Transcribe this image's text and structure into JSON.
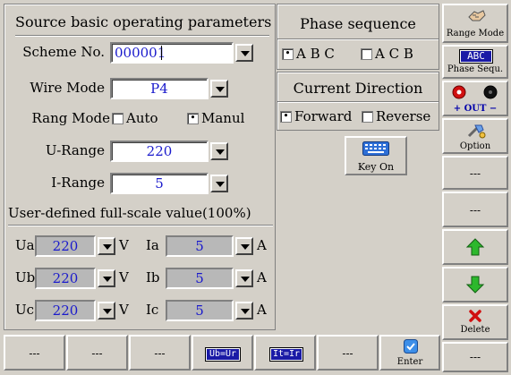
{
  "left_panel": {
    "title": "Source basic operating parameters",
    "scheme_label": "Scheme No.",
    "scheme_value": "000001",
    "wire_label": "Wire Mode",
    "wire_value": "P4",
    "rang_label": "Rang Mode",
    "rang_auto": "Auto",
    "rang_manual": "Manul",
    "u_range_label": "U-Range",
    "u_range_value": "220",
    "i_range_label": "I-Range",
    "i_range_value": "5",
    "fullscale_title": "User-defined full-scale value(100%)",
    "rows": [
      {
        "u_label": "Ua",
        "u_value": "220",
        "u_unit": "V",
        "i_label": "Ia",
        "i_value": "5",
        "i_unit": "A"
      },
      {
        "u_label": "Ub",
        "u_value": "220",
        "u_unit": "V",
        "i_label": "Ib",
        "i_value": "5",
        "i_unit": "A"
      },
      {
        "u_label": "Uc",
        "u_value": "220",
        "u_unit": "V",
        "i_label": "Ic",
        "i_value": "5",
        "i_unit": "A"
      }
    ]
  },
  "phase": {
    "title": "Phase sequence",
    "opt_abc": "A B C",
    "opt_acb": "A C B",
    "abc_checked": true
  },
  "current": {
    "title": "Current Direction",
    "opt_forward": "Forward",
    "opt_reverse": "Reverse",
    "forward_checked": true
  },
  "key_on": {
    "label": "Key On"
  },
  "sidebar": {
    "range_mode": "Range Mode",
    "phase_badge": "ABC",
    "phase_sequ": "Phase Sequ.",
    "out_label": "+ OUT −",
    "option": "Option",
    "blank1": "---",
    "blank2": "---",
    "blank3": "---",
    "delete": "Delete"
  },
  "bottom": {
    "b1": "---",
    "b2": "---",
    "b3": "---",
    "ub_ur": "Ub=Ur",
    "it_ir": "It=Ir",
    "b6": "---",
    "enter": "Enter"
  },
  "colors": {
    "value_blue": "#1a1acc",
    "badge_blue": "#1a1aa6",
    "arrow_green": "#2db82d",
    "delete_red": "#d01010"
  }
}
